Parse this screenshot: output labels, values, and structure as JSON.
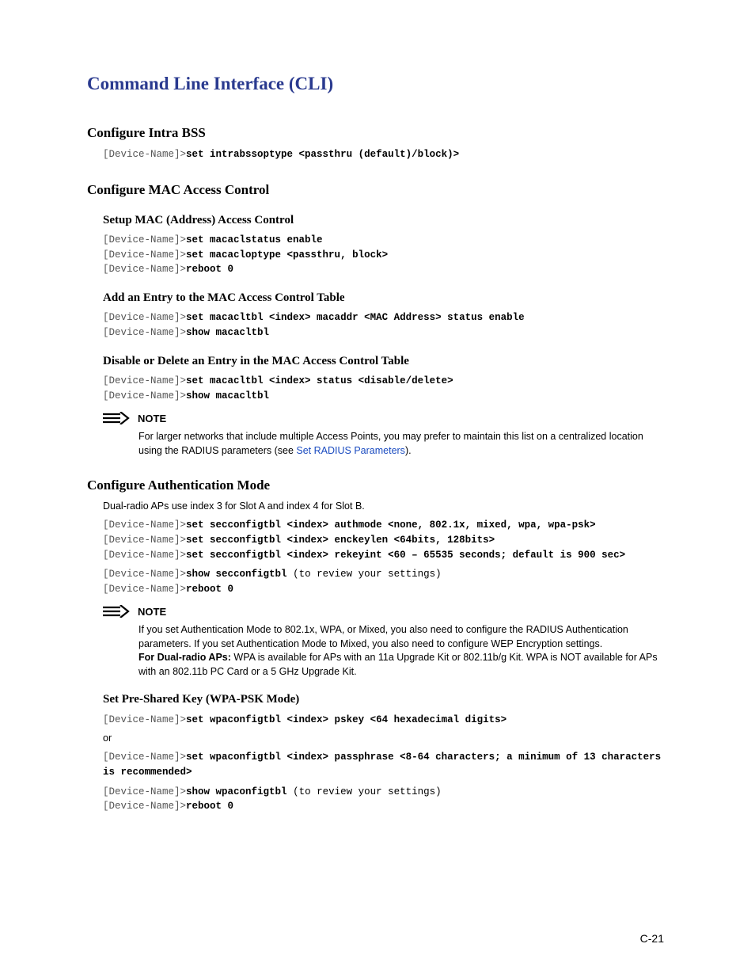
{
  "page_title": "Command Line Interface (CLI)",
  "pagenum": "C-21",
  "sections": {
    "intra_bss": {
      "heading": "Configure Intra BSS",
      "line1_prompt": "[Device-Name]>",
      "line1_cmd": "set intrabssoptype <passthru (default)/block)>"
    },
    "mac": {
      "heading": "Configure MAC Access Control",
      "setup": {
        "heading": "Setup MAC (Address) Access Control",
        "l1p": "[Device-Name]>",
        "l1c": "set macaclstatus enable",
        "l2p": "[Device-Name]>",
        "l2c": "set macacloptype <passthru, block>",
        "l3p": "[Device-Name]>",
        "l3c": "reboot 0"
      },
      "add": {
        "heading": "Add an Entry to the MAC Access Control Table",
        "l1p": "[Device-Name]>",
        "l1c": "set macacltbl <index> macaddr <MAC Address> status enable",
        "l2p": "[Device-Name]>",
        "l2c": "show macacltbl"
      },
      "del": {
        "heading": "Disable or Delete an Entry in the MAC Access Control Table",
        "l1p": "[Device-Name]>",
        "l1c": "set macacltbl <index> status <disable/delete>",
        "l2p": "[Device-Name]>",
        "l2c": "show macacltbl"
      },
      "note_label": "NOTE",
      "note_text_a": "For larger networks that include multiple Access Points, you may prefer to maintain this list on a centralized location using the RADIUS parameters (see ",
      "note_link": "Set RADIUS Parameters",
      "note_text_b": ")."
    },
    "auth": {
      "heading": "Configure Authentication Mode",
      "intro": "Dual-radio APs use index 3 for Slot A and index 4 for Slot B.",
      "l1p": "[Device-Name]>",
      "l1c": "set secconfigtbl <index> authmode <none, 802.1x, mixed, wpa, wpa-psk>",
      "l2p": "[Device-Name]>",
      "l2c": "set secconfigtbl <index> enckeylen <64bits, 128bits>",
      "l3p": "[Device-Name]>",
      "l3c": "set secconfigtbl <index> rekeyint <60 – 65535 seconds; default is 900 sec>",
      "l4p": "[Device-Name]>",
      "l4c": "show secconfigtbl",
      "l4n": " (to review your settings)",
      "l5p": "[Device-Name]>",
      "l5c": "reboot 0",
      "note_label": "NOTE",
      "note_text_a": "If you set Authentication Mode to 802.1x, WPA, or Mixed, you also need to configure the RADIUS Authentication parameters. If you set Authentication Mode to Mixed, you also need to configure WEP Encryption settings.",
      "note_bold": " For Dual-radio APs:",
      "note_text_b": " WPA is available for APs with an 11a Upgrade Kit or 802.11b/g Kit. WPA is NOT available for APs with an 802.11b PC Card or a 5 GHz Upgrade Kit.",
      "psk": {
        "heading": "Set Pre-Shared Key (WPA-PSK Mode)",
        "l1p": "[Device-Name]>",
        "l1c": "set wpaconfigtbl <index> pskey <64 hexadecimal digits>",
        "or": "or",
        "l2p": "[Device-Name]>",
        "l2c": "set wpaconfigtbl <index> passphrase <8-64 characters; a minimum of 13 characters is recommended>",
        "l3p": "[Device-Name]>",
        "l3c": "show wpaconfigtbl",
        "l3n": " (to review your settings)",
        "l4p": "[Device-Name]>",
        "l4c": "reboot 0"
      }
    }
  }
}
